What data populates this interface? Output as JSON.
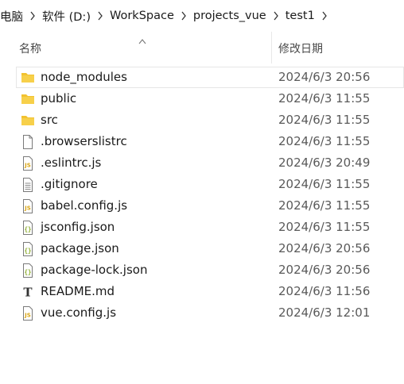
{
  "breadcrumb": [
    {
      "label": "电脑"
    },
    {
      "label": "软件 (D:)"
    },
    {
      "label": "WorkSpace"
    },
    {
      "label": "projects_vue"
    },
    {
      "label": "test1"
    }
  ],
  "columns": {
    "name": "名称",
    "date_modified": "修改日期"
  },
  "files": [
    {
      "name": "node_modules",
      "date": "2024/6/3 20:56",
      "icon": "folder-icon"
    },
    {
      "name": "public",
      "date": "2024/6/3 11:55",
      "icon": "folder-icon"
    },
    {
      "name": "src",
      "date": "2024/6/3 11:55",
      "icon": "folder-icon"
    },
    {
      "name": ".browserslistrc",
      "date": "2024/6/3 11:55",
      "icon": "blank-file-icon"
    },
    {
      "name": ".eslintrc.js",
      "date": "2024/6/3 20:49",
      "icon": "js-file-icon"
    },
    {
      "name": ".gitignore",
      "date": "2024/6/3 11:55",
      "icon": "text-file-icon"
    },
    {
      "name": "babel.config.js",
      "date": "2024/6/3 11:55",
      "icon": "js-file-icon"
    },
    {
      "name": "jsconfig.json",
      "date": "2024/6/3 11:55",
      "icon": "json-file-icon"
    },
    {
      "name": "package.json",
      "date": "2024/6/3 20:56",
      "icon": "json-file-icon"
    },
    {
      "name": "package-lock.json",
      "date": "2024/6/3 20:56",
      "icon": "json-file-icon"
    },
    {
      "name": "README.md",
      "date": "2024/6/3 11:56",
      "icon": "markdown-file-icon"
    },
    {
      "name": "vue.config.js",
      "date": "2024/6/3 12:01",
      "icon": "js-file-icon"
    }
  ],
  "colors": {
    "folder": "#f2c230",
    "js_badge": "#e4b620",
    "json_badge": "#8aab2a"
  }
}
